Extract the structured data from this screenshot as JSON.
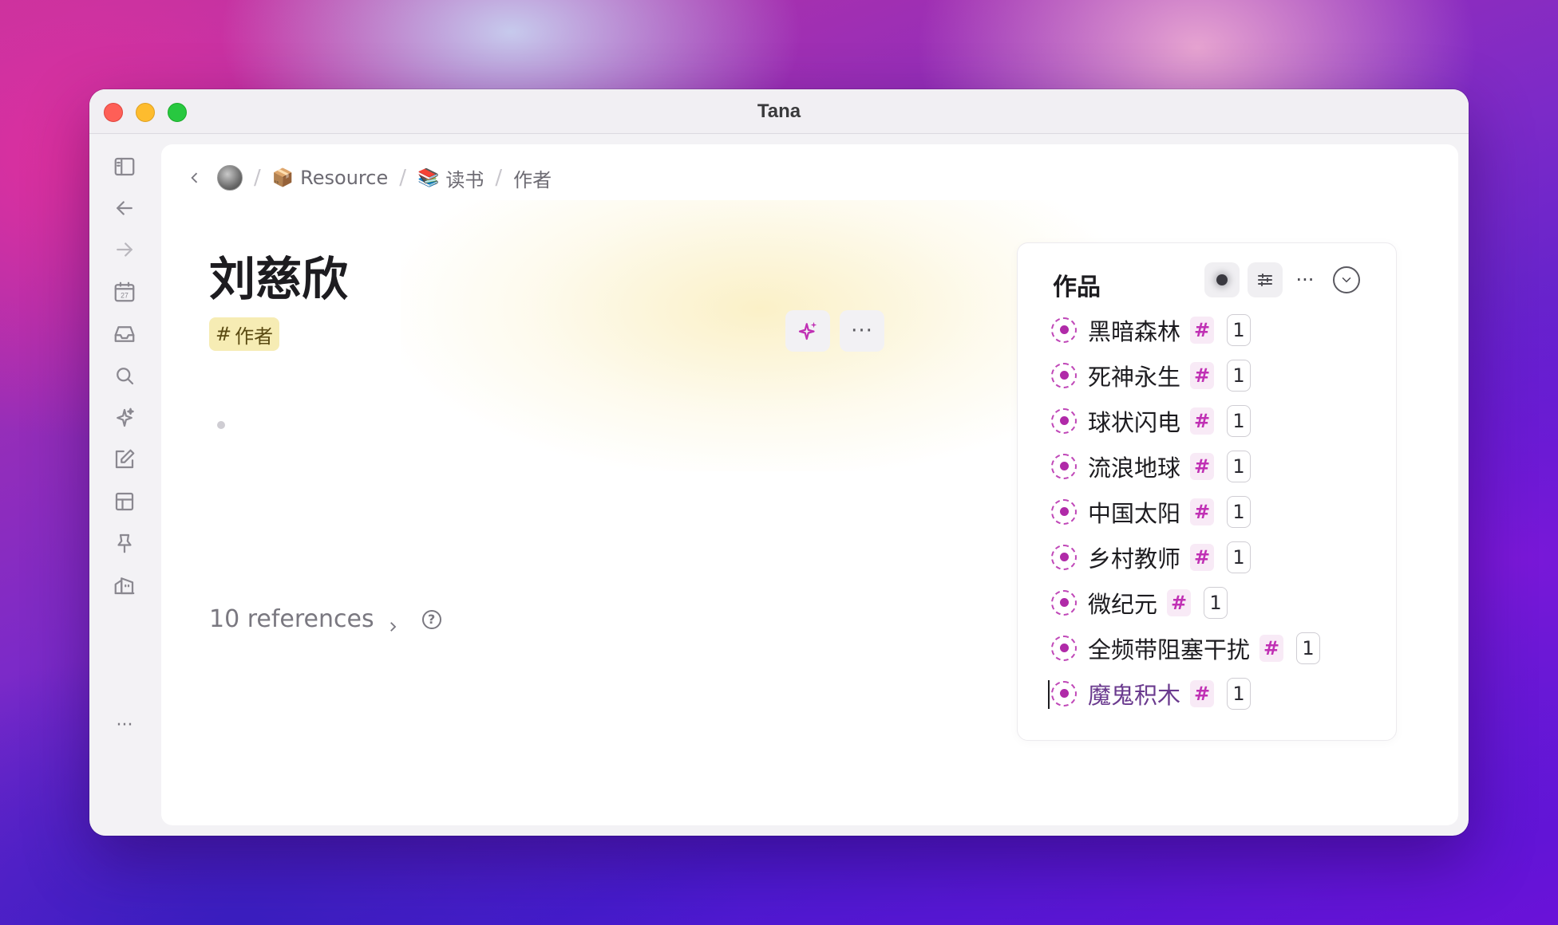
{
  "window": {
    "title": "Tana"
  },
  "sidebar": {
    "items": [
      {
        "name": "toggle-sidebar",
        "icon": "sidebar-icon"
      },
      {
        "name": "back",
        "icon": "arrow-left-icon"
      },
      {
        "name": "forward",
        "icon": "arrow-right-icon"
      },
      {
        "name": "calendar",
        "icon": "calendar-icon",
        "label": "27"
      },
      {
        "name": "inbox",
        "icon": "inbox-icon"
      },
      {
        "name": "search",
        "icon": "search-icon"
      },
      {
        "name": "ai",
        "icon": "sparkle-icon"
      },
      {
        "name": "edit",
        "icon": "edit-icon"
      },
      {
        "name": "layout",
        "icon": "layout-icon"
      },
      {
        "name": "pin",
        "icon": "pin-icon"
      },
      {
        "name": "workspace",
        "icon": "home-icon"
      },
      {
        "name": "more",
        "icon": "more-icon",
        "label": "···"
      }
    ]
  },
  "breadcrumb": {
    "items": [
      {
        "label": "Resource",
        "glyph": "📦"
      },
      {
        "label": "读书",
        "glyph": "📚"
      },
      {
        "label": "作者",
        "glyph": ""
      }
    ]
  },
  "page": {
    "title": "刘慈欣",
    "tag": "作者",
    "tag_prefix": "#",
    "more_label": "···",
    "references": "10 references",
    "help_label": "?"
  },
  "panel": {
    "title": "作品",
    "more_label": "···",
    "hash_label": "#",
    "items": [
      {
        "label": "黑暗森林",
        "count": "1"
      },
      {
        "label": "死神永生",
        "count": "1"
      },
      {
        "label": "球状闪电",
        "count": "1"
      },
      {
        "label": "流浪地球",
        "count": "1"
      },
      {
        "label": "中国太阳",
        "count": "1"
      },
      {
        "label": "乡村教师",
        "count": "1"
      },
      {
        "label": "微纪元",
        "count": "1"
      },
      {
        "label": "全频带阻塞干扰",
        "count": "1"
      },
      {
        "label": "魔鬼积木",
        "count": "1"
      }
    ]
  },
  "colors": {
    "accent": "#c030b4",
    "tag_bg": "#f6ecb4",
    "content_bg": "#ffffff"
  }
}
